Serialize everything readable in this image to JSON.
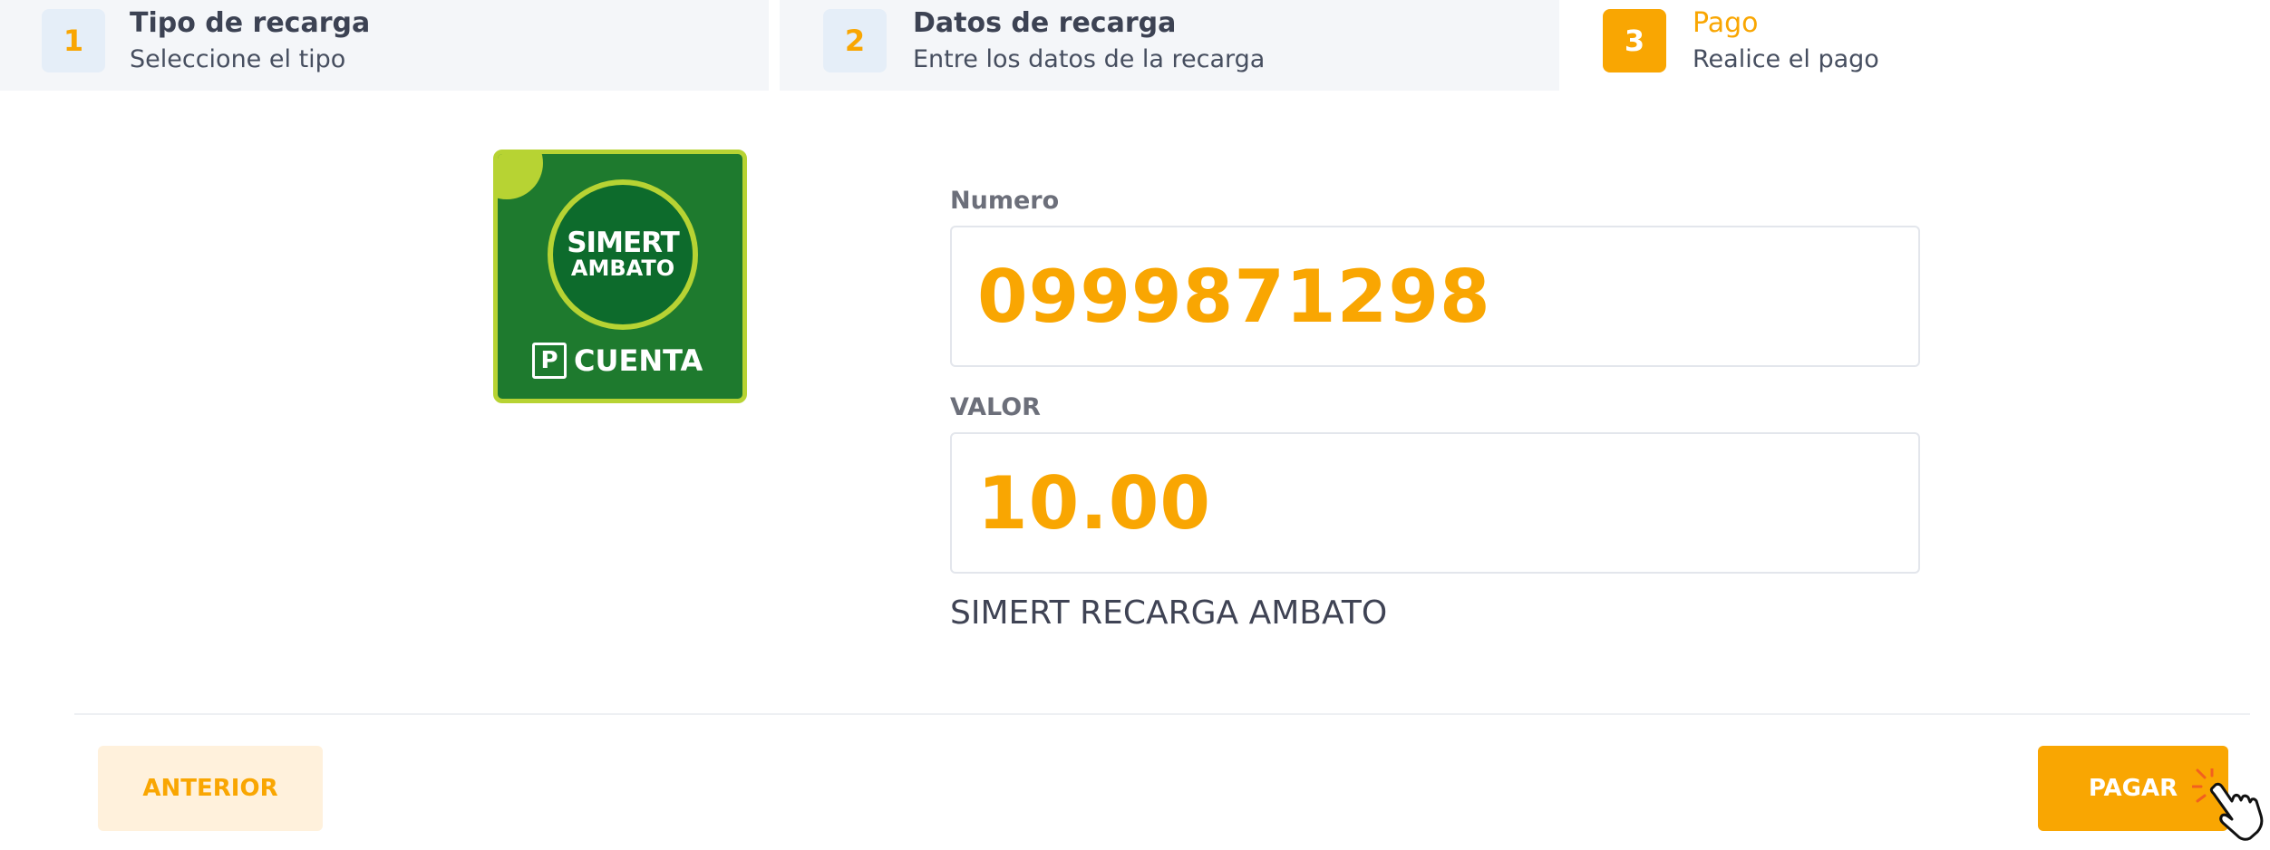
{
  "steps": [
    {
      "number": "1",
      "title": "Tipo de recarga",
      "subtitle": "Seleccione el tipo"
    },
    {
      "number": "2",
      "title": "Datos de recarga",
      "subtitle": "Entre los datos de la recarga"
    },
    {
      "number": "3",
      "title": "Pago",
      "subtitle": "Realice el pago"
    }
  ],
  "logo": {
    "line1": "SIMERT",
    "line2": "AMBATO",
    "parking_letter": "P",
    "line3": "CUENTA"
  },
  "form": {
    "numero_label": "Numero",
    "numero_value": "0999871298",
    "valor_label": "VALOR",
    "valor_value": "10.00",
    "description": "SIMERT RECARGA AMBATO"
  },
  "buttons": {
    "previous": "ANTERIOR",
    "pay": "PAGAR"
  },
  "colors": {
    "accent": "#f9a602",
    "step_bg": "#f4f6f9",
    "logo_green": "#1e7a2e",
    "logo_lime": "#b7d333"
  }
}
